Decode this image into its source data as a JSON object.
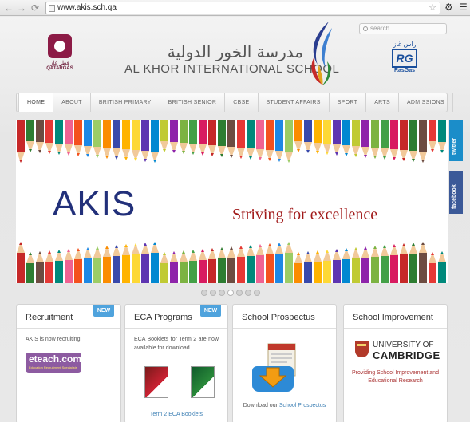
{
  "browser": {
    "url": "www.akis.sch.qa",
    "back_icon": "back-arrow-icon",
    "forward_icon": "forward-arrow-icon",
    "reload_icon": "reload-icon"
  },
  "header": {
    "search_placeholder": "search ...",
    "qatargas_arabic": "قطر غاز",
    "qatargas_label": "QATARGAS",
    "school_arabic": "مدرسة الخور الدولية",
    "school_english": "AL KHOR INTERNATIONAL SCHOOL",
    "rasgas_arabic": "راس غاز",
    "rasgas_mark": "RG",
    "rasgas_label": "RasGas"
  },
  "nav": [
    "HOME",
    "ABOUT",
    "BRITISH PRIMARY",
    "BRITISH SENIOR",
    "CBSE",
    "STUDENT AFFAIRS",
    "SPORT",
    "ARTS",
    "ADMISSIONS"
  ],
  "banner": {
    "heading": "AKIS",
    "slogan": "Striving for excellence",
    "slide_count": 7,
    "active_slide": 4
  },
  "side_tabs": {
    "twitter": "twitter",
    "facebook": "facebook"
  },
  "cards": {
    "recruitment": {
      "title": "Recruitment",
      "badge": "NEW",
      "text": "AKIS is now recruiting.",
      "eteach_logo": "eteach.com",
      "eteach_tagline": "Education Recruitment Specialists"
    },
    "eca": {
      "title": "ECA Programs",
      "badge": "NEW",
      "text": "ECA Booklets for Term 2 are now available for download.",
      "link": "Term 2 ECA Booklets"
    },
    "prospectus": {
      "title": "School Prospectus",
      "text_prefix": "Download our",
      "link": "School Prospectus"
    },
    "improvement": {
      "title": "School Improvement",
      "cam_line1": "UNIVERSITY OF",
      "cam_line2": "CAMBRIDGE",
      "text": "Providing School Improvement and Educational Research"
    }
  }
}
